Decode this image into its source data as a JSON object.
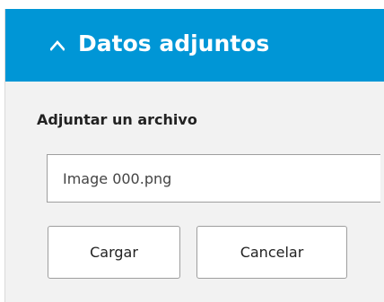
{
  "header": {
    "title": "Datos adjuntos",
    "toggle_icon": "chevron-up-icon"
  },
  "attach": {
    "label": "Adjuntar un archivo",
    "file_value": "Image 000.png",
    "upload_label": "Cargar",
    "cancel_label": "Cancelar"
  },
  "colors": {
    "header_bg": "#0096d6",
    "panel_bg": "#f2f2f2"
  }
}
